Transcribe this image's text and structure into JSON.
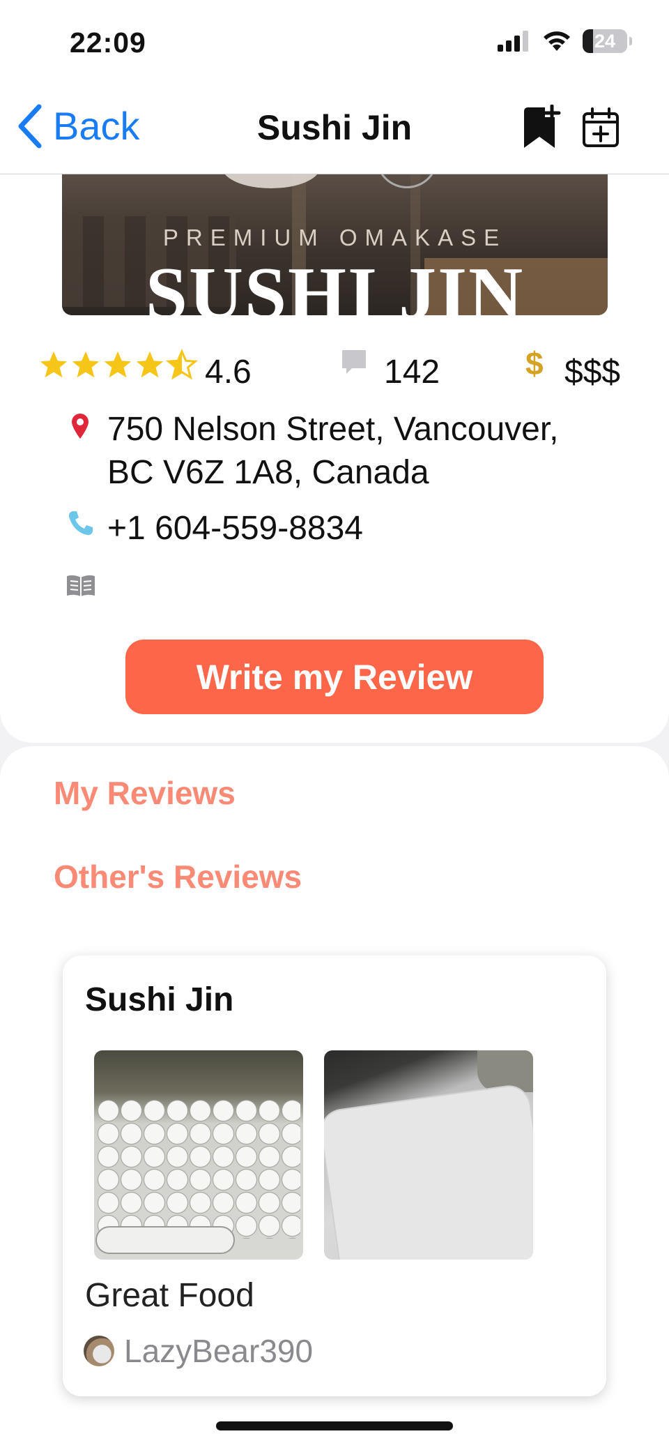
{
  "status_bar": {
    "time": "22:09",
    "battery": "24"
  },
  "nav": {
    "back_label": "Back",
    "title": "Sushi Jin",
    "icons": [
      "bookmark-add-icon",
      "calendar-add-icon"
    ]
  },
  "hero": {
    "subtitle": "PREMIUM OMAKASE",
    "title": "SUSHI JIN"
  },
  "stats": {
    "rating": "4.6",
    "stars": 4.5,
    "review_count": "142",
    "price_level": "$$$"
  },
  "address": {
    "line1": "750 Nelson Street, Vancouver,",
    "line2": "BC V6Z 1A8, Canada"
  },
  "phone": "+1 604-559-8834",
  "write_review_label": "Write my Review",
  "sections": {
    "my_reviews": "My Reviews",
    "others_reviews": "Other's Reviews"
  },
  "review": {
    "restaurant": "Sushi Jin",
    "text": "Great Food",
    "reviewer": "LazyBear390"
  },
  "colors": {
    "accent": "#fe664a",
    "section_heading": "#fa8a76",
    "link_blue": "#1a7cf5",
    "star": "#f5c518",
    "dollar": "#d4a326",
    "pin": "#e0263a",
    "phone": "#6cc6ea"
  }
}
